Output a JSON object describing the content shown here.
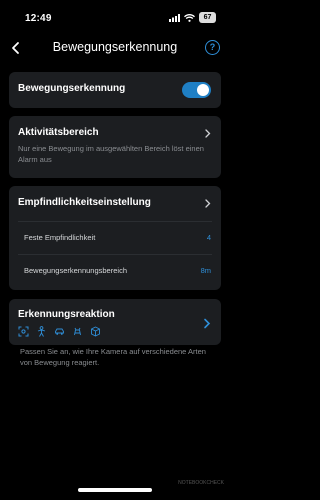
{
  "status_bar": {
    "time": "12:49",
    "battery": "67"
  },
  "header": {
    "title": "Bewegungserkennung",
    "back_icon": "chevron-left-icon",
    "help_icon": "?"
  },
  "motion_toggle": {
    "label": "Bewegungserkennung",
    "enabled": true
  },
  "activity_area": {
    "title": "Aktivitätsbereich",
    "description": "Nur eine Bewegung im ausgewählten Bereich löst einen Alarm aus"
  },
  "sensitivity": {
    "title": "Empfindlichkeitseinstellung",
    "rows": [
      {
        "label": "Feste Empfindlichkeit",
        "value": "4"
      },
      {
        "label": "Bewegungserkennungsbereich",
        "value": "8m"
      }
    ]
  },
  "detection_response": {
    "title": "Erkennungsreaktion",
    "icons": [
      "motion-frame-icon",
      "person-icon",
      "car-icon",
      "pet-icon",
      "package-icon"
    ],
    "footer": "Passen Sie an, wie Ihre Kamera auf verschiedene Arten von Bewegung reagiert."
  },
  "watermark": "NOTEBOOKCHECK",
  "colors": {
    "accent": "#2f8fd8",
    "toggle_on": "#1f7fc4",
    "card_bg": "#1c1e21",
    "background": "#000000"
  }
}
